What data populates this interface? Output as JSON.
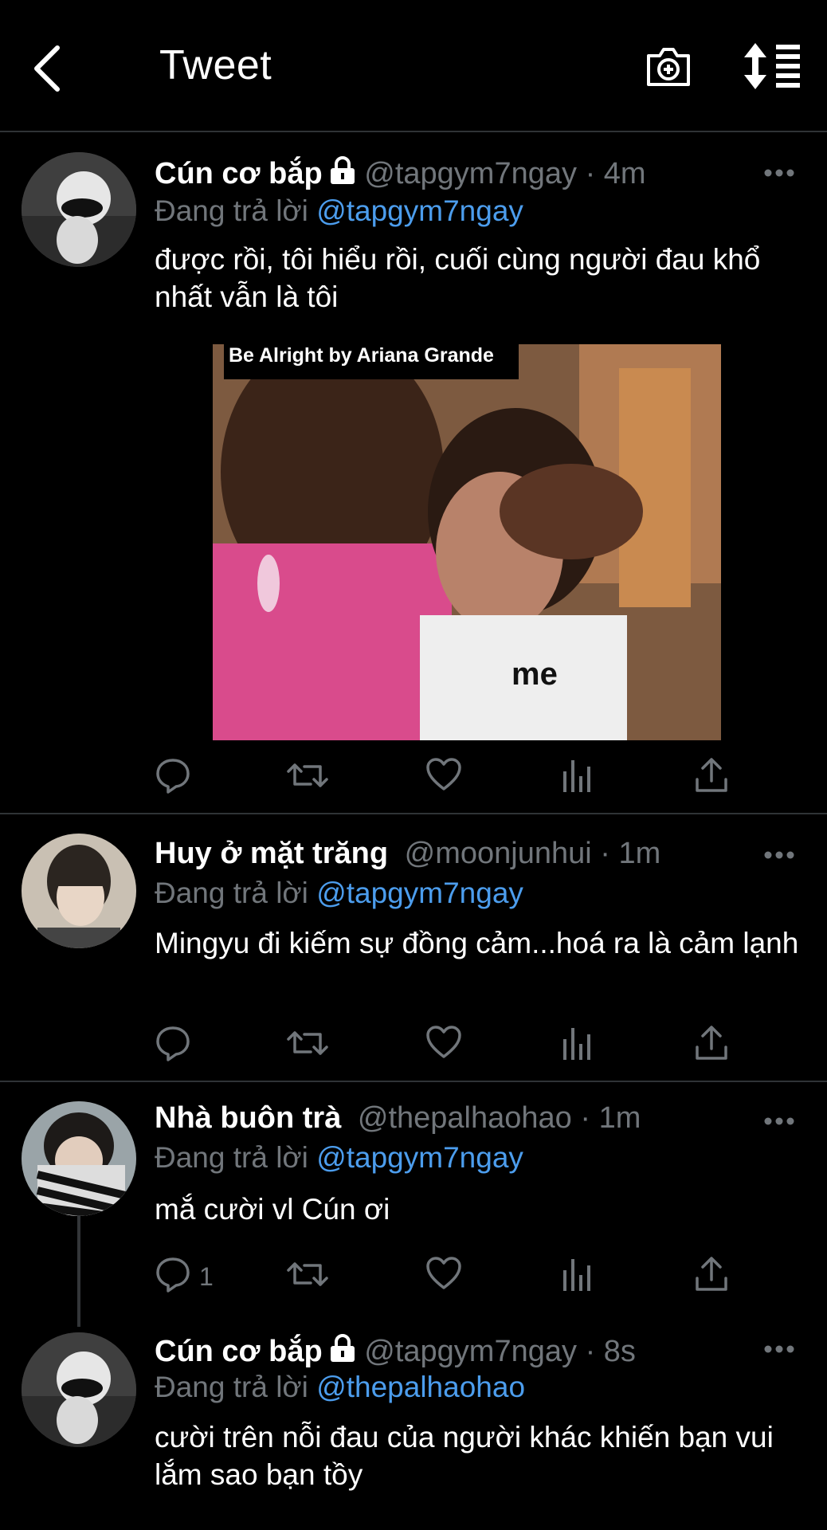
{
  "header": {
    "title": "Tweet",
    "back_icon": "chevron-left-icon",
    "camera_icon": "camera-plus-icon",
    "sort_icon": "sort-icon"
  },
  "tweets": [
    {
      "name": "Cún cơ bắp",
      "locked": true,
      "handle": "@tapgym7ngay",
      "time": "· 4m",
      "reply_prefix": "Đang trả lời",
      "reply_to": "@tapgym7ngay",
      "text": "được rồi, tôi hiểu rồi, cuối cùng người đau khổ nhất vẫn là tôi",
      "media": {
        "caption": "Be Alright by Ariana Grande",
        "label": "me"
      }
    },
    {
      "name": "Huy ở mặt trăng",
      "locked": false,
      "handle": "@moonjunhui",
      "time": "· 1m",
      "reply_prefix": "Đang trả lời",
      "reply_to": "@tapgym7ngay",
      "text": "Mingyu đi kiếm sự đồng cảm...hoá ra là cảm lạnh"
    },
    {
      "name": "Nhà buôn trà",
      "locked": false,
      "handle": "@thepalhaohao",
      "time": "· 1m",
      "reply_prefix": "Đang trả lời",
      "reply_to": "@tapgym7ngay",
      "text": "mắ cười vl Cún ơi",
      "reply_count": "1"
    },
    {
      "name": "Cún cơ bắp",
      "locked": true,
      "handle": "@tapgym7ngay",
      "time": "· 8s",
      "reply_prefix": "Đang trả lời",
      "reply_to": "@thepalhaohao",
      "text": "cười trên nỗi đau của người khác khiến bạn vui lắm sao bạn tồy"
    }
  ],
  "colors": {
    "background": "#000000",
    "handle": "#71767b",
    "link": "#4c9ded",
    "divider": "#2f3336"
  }
}
